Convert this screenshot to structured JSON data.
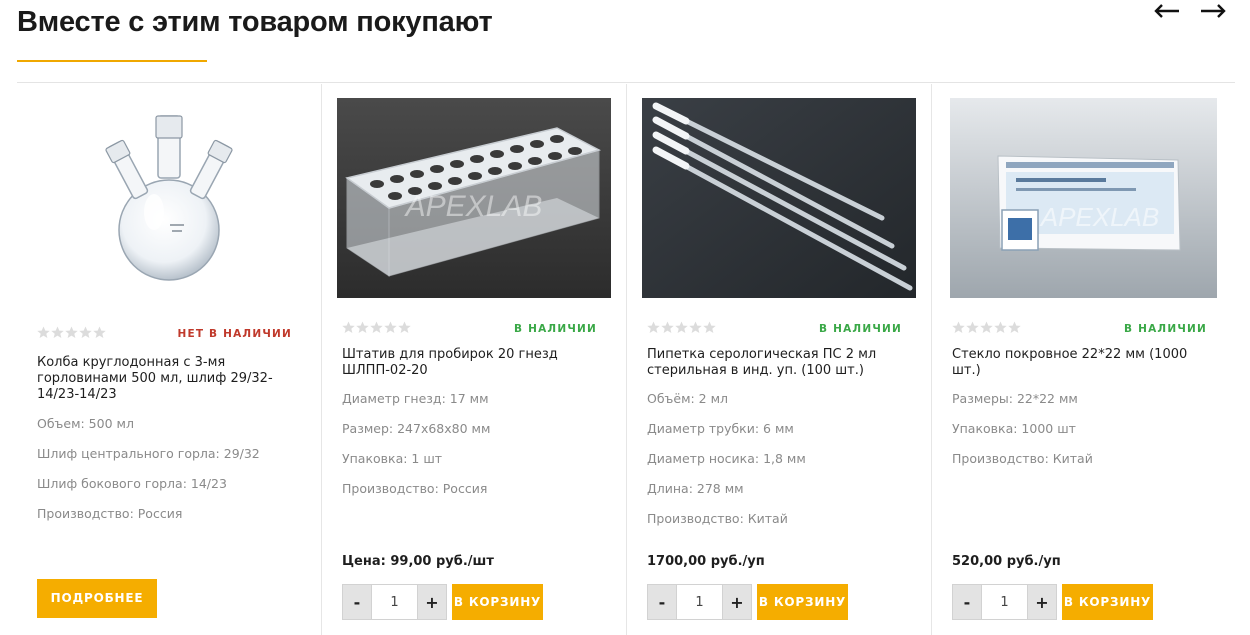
{
  "section": {
    "title": "Вместе с этим товаром покупают",
    "accent_color": "#f0a800",
    "prev_icon": "arrow-left-icon",
    "next_icon": "arrow-right-icon"
  },
  "products": [
    {
      "image": "round-bottom-flask-photo",
      "rating": 0,
      "stock": "НЕТ В НАЛИЧИИ",
      "name": "Колба круглодонная с 3-мя горловинами 500 мл, шлиф 29/32-14/23-14/23",
      "props": [
        "Объем: 500 мл",
        "Шлиф центрального горла: 29/32",
        "Шлиф бокового горла: 14/23",
        "Производство: Россия"
      ],
      "button": "ПОДРОБНЕЕ"
    },
    {
      "image": "test-tube-rack-photo",
      "watermark": "APEXLAB",
      "rating": 0,
      "stock": "В НАЛИЧИИ",
      "name": "Штатив для пробирок 20 гнезд ШЛПП-02-20",
      "props": [
        "Диаметр гнезд: 17 мм",
        "Размер: 247х68х80 мм",
        "Упаковка: 1 шт",
        "Производство: Россия"
      ],
      "price": "Цена: 99,00 руб./шт",
      "qty": {
        "minus": "-",
        "value": "1",
        "plus": "+"
      },
      "cart": "В КОРЗИНУ"
    },
    {
      "image": "serological-pipettes-photo",
      "rating": 0,
      "stock": "В НАЛИЧИИ",
      "name": "Пипетка серологическая ПС 2 мл стерильная в инд. уп. (100 шт.)",
      "props": [
        "Объём: 2 мл",
        "Диаметр трубки: 6 мм",
        "Диаметр носика: 1,8 мм",
        "Длина: 278 мм",
        "Производство: Китай"
      ],
      "price": "1700,00 руб./уп",
      "qty": {
        "minus": "-",
        "value": "1",
        "plus": "+"
      },
      "cart": "В КОРЗИНУ"
    },
    {
      "image": "cover-glass-box-photo",
      "watermark": "APEXLAB",
      "rating": 0,
      "stock": "В НАЛИЧИИ",
      "name": "Стекло покровное 22*22 мм (1000 шт.)",
      "props": [
        "Размеры: 22*22 мм",
        "Упаковка: 1000 шт",
        "Производство: Китай"
      ],
      "price": "520,00 руб./уп",
      "qty": {
        "minus": "-",
        "value": "1",
        "plus": "+"
      },
      "cart": "В КОРЗИНУ"
    }
  ]
}
